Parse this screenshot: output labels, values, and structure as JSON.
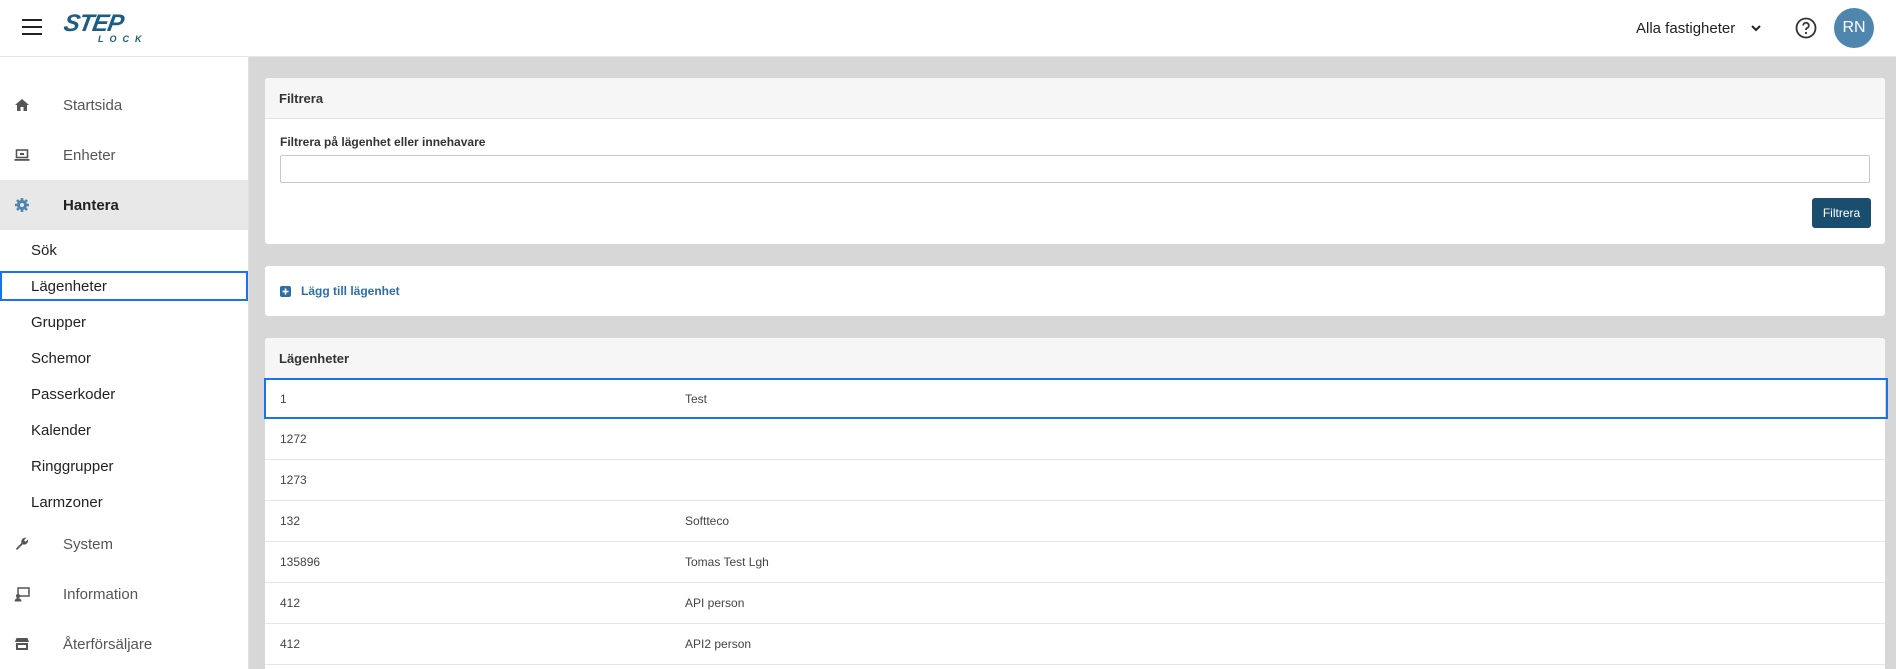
{
  "header": {
    "logo_step": "STEP",
    "logo_lock": "LOCK",
    "property_select": "Alla fastigheter",
    "avatar_initials": "RN"
  },
  "sidebar": {
    "items": [
      {
        "label": "Startsida",
        "icon": "home-icon"
      },
      {
        "label": "Enheter",
        "icon": "laptop-icon"
      },
      {
        "label": "Hantera",
        "icon": "gear-icon"
      },
      {
        "label": "System",
        "icon": "wrench-icon"
      },
      {
        "label": "Information",
        "icon": "info-screen-icon"
      },
      {
        "label": "Återförsäljare",
        "icon": "store-icon"
      }
    ],
    "subitems": [
      {
        "label": "Sök"
      },
      {
        "label": "Lägenheter"
      },
      {
        "label": "Grupper"
      },
      {
        "label": "Schemor"
      },
      {
        "label": "Passerkoder"
      },
      {
        "label": "Kalender"
      },
      {
        "label": "Ringgrupper"
      },
      {
        "label": "Larmzoner"
      }
    ]
  },
  "filter": {
    "title": "Filtrera",
    "label": "Filtrera på lägenhet eller innehavare",
    "value": "",
    "button": "Filtrera"
  },
  "add": {
    "label": "Lägg till lägenhet"
  },
  "apartments": {
    "title": "Lägenheter",
    "rows": [
      {
        "number": "1",
        "holder": "Test"
      },
      {
        "number": "1272",
        "holder": ""
      },
      {
        "number": "1273",
        "holder": ""
      },
      {
        "number": "132",
        "holder": "Softteco"
      },
      {
        "number": "135896",
        "holder": "Tomas Test Lgh"
      },
      {
        "number": "412",
        "holder": "API person"
      },
      {
        "number": "412",
        "holder": "API2 person"
      }
    ]
  },
  "colors": {
    "accent": "#1a4e6e",
    "link": "#2e6ea6",
    "selection": "#1a73e8",
    "avatar": "#4e86ad"
  }
}
